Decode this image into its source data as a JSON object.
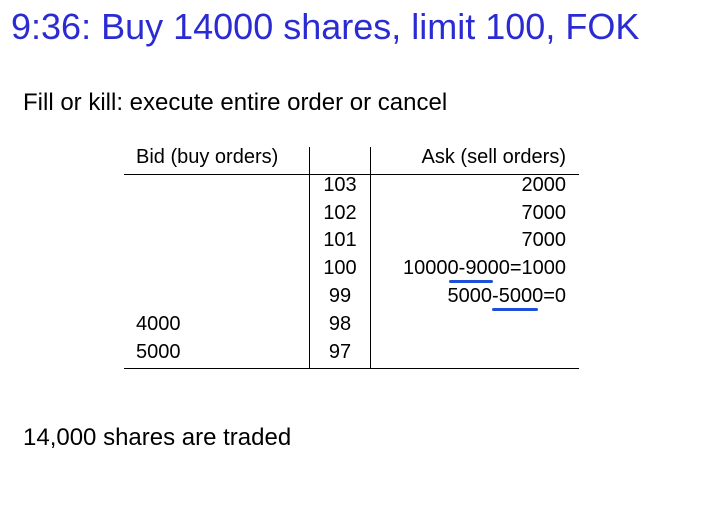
{
  "title": "9:36: Buy 14000 shares, limit 100, FOK",
  "subtitle": "Fill or kill: execute entire order or cancel",
  "order_book": {
    "bid_header": "Bid (buy orders)",
    "ask_header": "Ask (sell orders)",
    "rows": [
      {
        "bid": "",
        "price": "103",
        "ask": "2000"
      },
      {
        "bid": "",
        "price": "102",
        "ask": "7000"
      },
      {
        "bid": "",
        "price": "101",
        "ask": "7000"
      },
      {
        "bid": "",
        "price": "100",
        "ask": "10000-9000=1000"
      },
      {
        "bid": "",
        "price": "99",
        "ask": "5000-5000=0"
      },
      {
        "bid": "4000",
        "price": "98",
        "ask": ""
      },
      {
        "bid": "5000",
        "price": "97",
        "ask": ""
      }
    ]
  },
  "annotation_color": "#1e4fd8",
  "footer": "14,000 shares are traded"
}
